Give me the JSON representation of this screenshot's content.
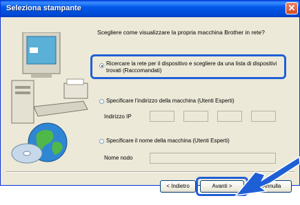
{
  "window": {
    "title": "Seleziona stampante"
  },
  "question": "Scegliere come visualizzare la propria macchina Brother in rete?",
  "options": [
    {
      "label_line1": "Ricercare la rete per il dispositivo e scegliere da una lista di dispositivi",
      "label_line2": "trovati (Raccomandati)",
      "checked": true
    },
    {
      "label": "Specificare l'indirizzo della macchina (Utenti Esperti)",
      "checked": false
    },
    {
      "label": "Specificare il nome della macchina (Utenti Esperti)",
      "checked": false
    }
  ],
  "ip": {
    "label": "Indirizzo IP",
    "octets": [
      "",
      "",
      "",
      ""
    ]
  },
  "node": {
    "label": "Nome nodo",
    "value": ""
  },
  "buttons": {
    "back": "< Indietro",
    "next": "Avanti >",
    "cancel": "Annulla"
  },
  "colors": {
    "titlebar": "#0058e6",
    "highlight": "#1f5fd6",
    "dialog_bg": "#ece9d8"
  }
}
